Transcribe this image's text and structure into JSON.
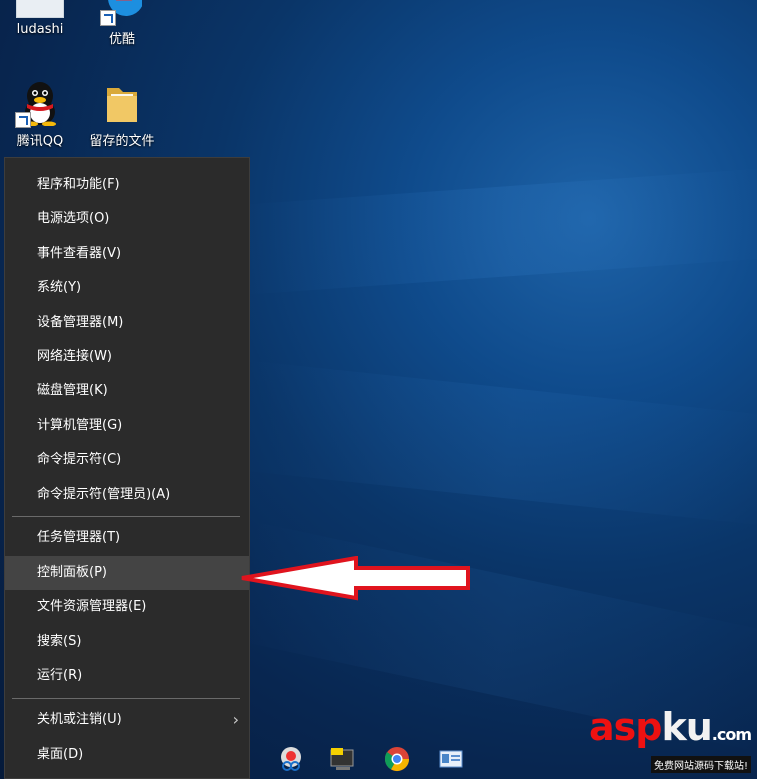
{
  "desktop": {
    "icons": [
      {
        "label": "ludashi"
      },
      {
        "label": "优酷"
      },
      {
        "label": "腾讯QQ"
      },
      {
        "label": "留存的文件"
      }
    ]
  },
  "menu": {
    "items": [
      {
        "label": "程序和功能(F)"
      },
      {
        "label": "电源选项(O)"
      },
      {
        "label": "事件查看器(V)"
      },
      {
        "label": "系统(Y)"
      },
      {
        "label": "设备管理器(M)"
      },
      {
        "label": "网络连接(W)"
      },
      {
        "label": "磁盘管理(K)"
      },
      {
        "label": "计算机管理(G)"
      },
      {
        "label": "命令提示符(C)"
      },
      {
        "label": "命令提示符(管理员)(A)"
      },
      {
        "label": "任务管理器(T)"
      },
      {
        "label": "控制面板(P)"
      },
      {
        "label": "文件资源管理器(E)"
      },
      {
        "label": "搜索(S)"
      },
      {
        "label": "运行(R)"
      },
      {
        "label": "关机或注销(U)"
      },
      {
        "label": "桌面(D)"
      }
    ],
    "highlighted": "控制面板(P)"
  },
  "watermark": {
    "brand_a": "asp",
    "brand_b": "ku",
    "domain": ".com",
    "subtitle": "免费网站源码下载站!"
  },
  "colors": {
    "menu_bg": "#2b2b2b",
    "menu_highlight": "#444444",
    "arrow": "#e0141e"
  }
}
